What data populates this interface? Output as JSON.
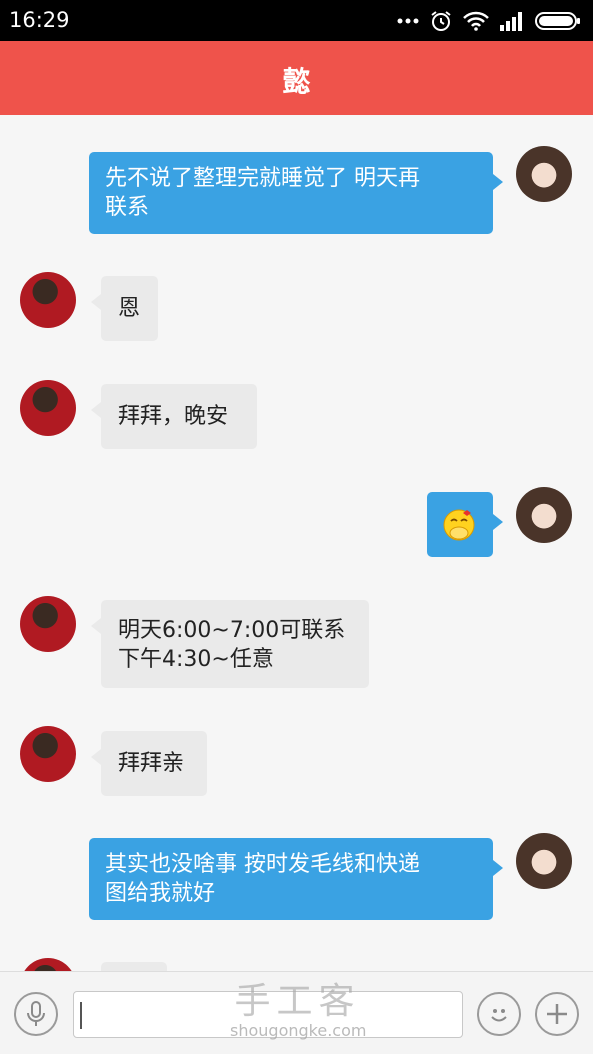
{
  "status_bar": {
    "time": "16:29",
    "icons": [
      "more-dots-icon",
      "alarm-icon",
      "wifi-icon",
      "signal-icon",
      "battery-icon"
    ]
  },
  "header": {
    "title": "懿"
  },
  "messages": [
    {
      "direction": "out",
      "lines": [
        "先不说了整理完就睡觉了 明天再",
        "联系"
      ]
    },
    {
      "direction": "in",
      "lines": [
        "恩"
      ]
    },
    {
      "direction": "in",
      "lines": [
        "拜拜，晚安"
      ]
    },
    {
      "direction": "out",
      "emoji": "covering-mouth-emoji-icon"
    },
    {
      "direction": "in",
      "lines": [
        "明天6:00~7:00可联系",
        "下午4:30~任意"
      ]
    },
    {
      "direction": "in",
      "lines": [
        "拜拜亲"
      ]
    },
    {
      "direction": "out",
      "lines": [
        "其实也没啥事 按时发毛线和快递",
        "图给我就好"
      ]
    }
  ],
  "input_bar": {
    "text_value": "",
    "icons": [
      "microphone-icon",
      "emoji-icon",
      "plus-icon"
    ]
  },
  "watermark": {
    "big": "手工客",
    "small": "shougongke.com"
  },
  "colors": {
    "header": "#ef534b",
    "outgoing_bubble": "#3aa2e3",
    "incoming_bubble": "#eaeaea"
  }
}
